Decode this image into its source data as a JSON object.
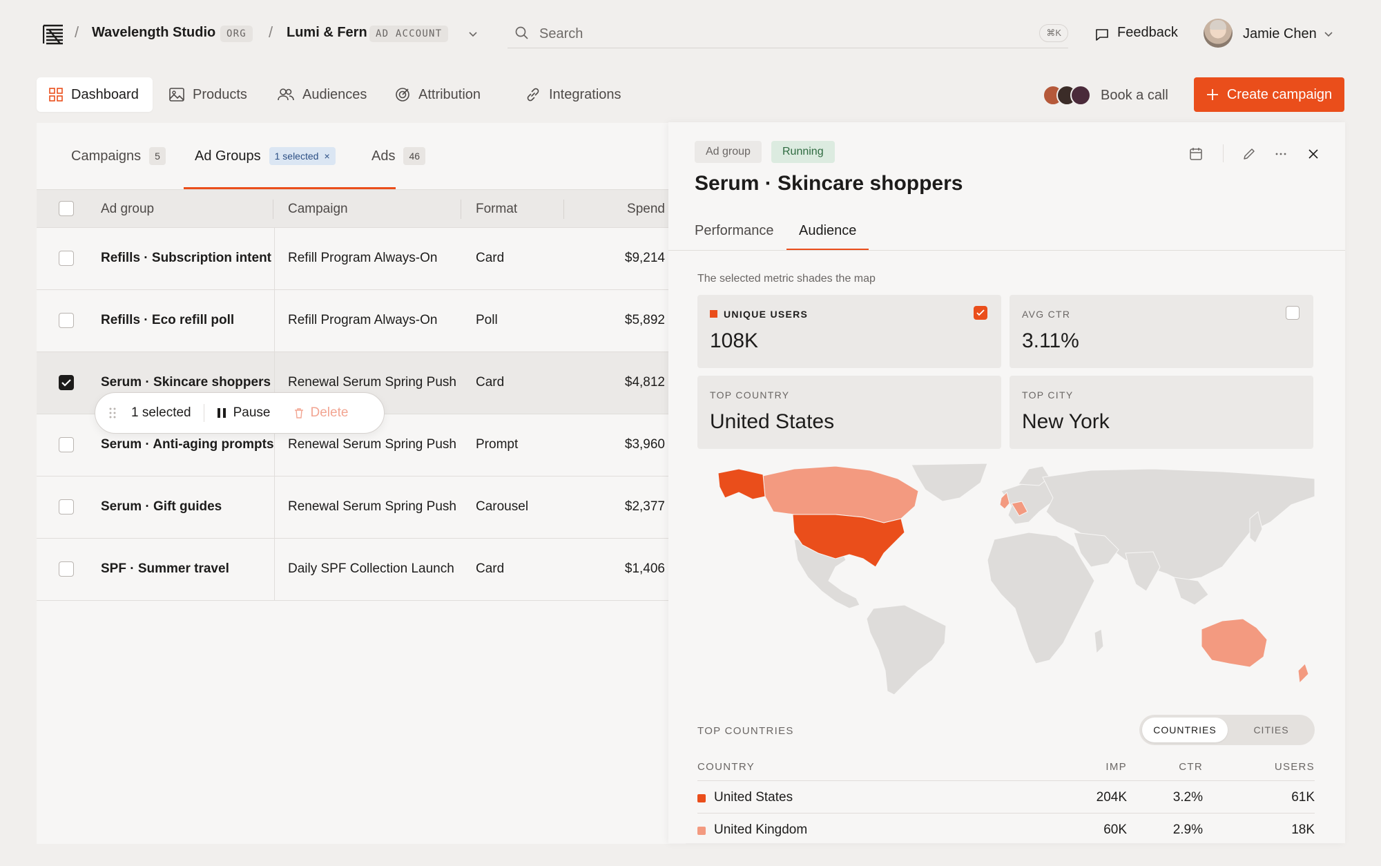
{
  "header": {
    "org_name": "Wavelength Studio",
    "org_tag": "ORG",
    "account_name": "Lumi & Fern",
    "account_tag": "AD ACCOUNT",
    "search_placeholder": "Search",
    "search_shortcut": "⌘K",
    "feedback_label": "Feedback",
    "user_name": "Jamie Chen"
  },
  "nav": {
    "items": [
      {
        "label": "Dashboard",
        "icon": "grid-icon",
        "active": true
      },
      {
        "label": "Products",
        "icon": "image-icon"
      },
      {
        "label": "Audiences",
        "icon": "users-icon"
      },
      {
        "label": "Attribution",
        "icon": "target-icon"
      },
      {
        "label": "Integrations",
        "icon": "link-icon"
      }
    ],
    "book_call_label": "Book a call",
    "create_label": "Create campaign"
  },
  "list": {
    "tabs": [
      {
        "label": "Campaigns",
        "count": "5"
      },
      {
        "label": "Ad Groups",
        "selected": "1 selected",
        "active": true
      },
      {
        "label": "Ads",
        "count": "46"
      }
    ],
    "columns": [
      "Ad group",
      "Campaign",
      "Format",
      "Spend"
    ],
    "rows": [
      {
        "ad_group": "Refills · Subscription intent",
        "campaign": "Refill Program Always-On",
        "format": "Card",
        "spend": "$9,214",
        "checked": false
      },
      {
        "ad_group": "Refills · Eco refill poll",
        "campaign": "Refill Program Always-On",
        "format": "Poll",
        "spend": "$5,892",
        "checked": false
      },
      {
        "ad_group": "Serum · Skincare shoppers",
        "campaign": "Renewal Serum Spring Push",
        "format": "Card",
        "spend": "$4,812",
        "checked": true
      },
      {
        "ad_group": "Serum · Anti-aging prompts",
        "campaign": "Renewal Serum Spring Push",
        "format": "Prompt",
        "spend": "$3,960",
        "checked": false
      },
      {
        "ad_group": "Serum · Gift guides",
        "campaign": "Renewal Serum Spring Push",
        "format": "Carousel",
        "spend": "$2,377",
        "checked": false
      },
      {
        "ad_group": "SPF · Summer travel",
        "campaign": "Daily SPF Collection Launch",
        "format": "Card",
        "spend": "$1,406",
        "checked": false
      }
    ],
    "bulk_bar": {
      "selected_label": "1 selected",
      "pause_label": "Pause",
      "delete_label": "Delete"
    }
  },
  "panel": {
    "type_badge": "Ad group",
    "status_badge": "Running",
    "title": "Serum · Skincare shoppers",
    "tabs": [
      "Performance",
      "Audience"
    ],
    "active_tab": "Audience",
    "hint": "The selected metric shades the map",
    "metrics": [
      {
        "label": "UNIQUE USERS",
        "value": "108K",
        "selected": true
      },
      {
        "label": "AVG CTR",
        "value": "3.11%",
        "selected": false
      },
      {
        "label": "TOP COUNTRY",
        "value": "United States"
      },
      {
        "label": "TOP CITY",
        "value": "New York"
      }
    ],
    "section_title": "TOP COUNTRIES",
    "toggle": [
      "COUNTRIES",
      "CITIES"
    ],
    "table_headers": [
      "COUNTRY",
      "IMP",
      "CTR",
      "USERS"
    ],
    "countries": [
      {
        "name": "United States",
        "imp": "204K",
        "ctr": "3.2%",
        "users": "61K",
        "color": "#ea4e1b"
      },
      {
        "name": "United Kingdom",
        "imp": "60K",
        "ctr": "2.9%",
        "users": "18K",
        "color": "#f39a80"
      }
    ]
  },
  "colors": {
    "accent": "#ea4e1b",
    "accent_light": "#f39a80",
    "running_bg": "#dcebe0",
    "running_text": "#2f6b41"
  }
}
